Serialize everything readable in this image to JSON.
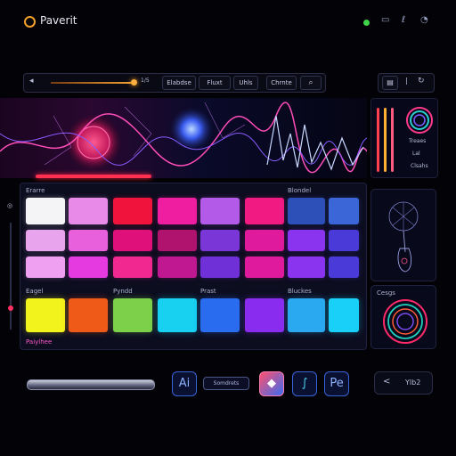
{
  "header": {
    "title": "Paverit"
  },
  "toolbar": {
    "volume_value": "1/5",
    "buttons": [
      "Elabdse",
      "Fluxt",
      "Uhls",
      "Chrnte"
    ],
    "search_icon": "search-icon",
    "right_icons": [
      "folder-icon",
      "divider",
      "sync-icon"
    ]
  },
  "meters": {
    "label_1": "Treaes",
    "label_2": "Lal",
    "label_3": "Clsahs"
  },
  "grid": {
    "label_top_left": "Erarre",
    "label_top_right": "Blondel",
    "label_mid_1": "Eagel",
    "label_mid_2": "Pyndd",
    "label_mid_3": "Prast",
    "label_mid_4": "Bluckes",
    "footer_label": "Paiylhee",
    "rows": [
      [
        "#f4f4f6",
        "#e88be8",
        "#f0143c",
        "#ef1ea0",
        "#b45ae8",
        "#f01a82",
        "#2c4fb8",
        "#3a66d8"
      ],
      [
        "#e8a4ec",
        "#e860dc",
        "#e0107a",
        "#b0136e",
        "#7a36d6",
        "#e01a9c",
        "#8a34f0",
        "#4a3ad8"
      ],
      [
        "#f0a0f0",
        "#e43ae0",
        "#f02890",
        "#c01890",
        "#7030d8",
        "#e01a9c",
        "#8a34f0",
        "#4a3ad8"
      ],
      [
        "#f2f21c",
        "#f05a18",
        "#7cd04a",
        "#18d0f0",
        "#2a6cf0",
        "#8a2cf0",
        "#2aa8f0",
        "#18d0f8"
      ]
    ]
  },
  "right_panel": {
    "label": "Cesgs"
  },
  "footer": {
    "app_icon_1": "Ai",
    "field_text": "Somdrets",
    "app_icon_4": "Pe",
    "share_text": "Ylb2"
  },
  "colors": {
    "accent": "#f0a02a",
    "brand": "#3a63d8",
    "status_ok": "#3fd44a"
  }
}
